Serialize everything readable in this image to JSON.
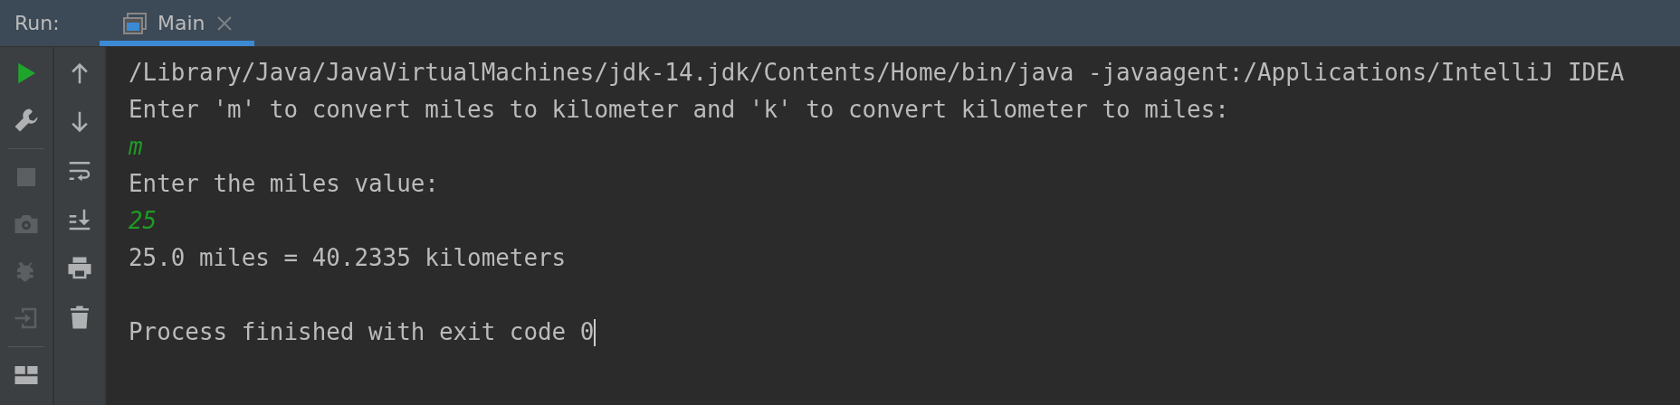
{
  "header": {
    "label": "Run:",
    "tabs": [
      {
        "label": "Main",
        "selected": true
      }
    ]
  },
  "toolbar": [
    {
      "kind": "run",
      "disabled": false
    },
    {
      "kind": "wrench",
      "disabled": false
    },
    {
      "kind": "separator"
    },
    {
      "kind": "stop",
      "disabled": true
    },
    {
      "kind": "camera",
      "disabled": true
    },
    {
      "kind": "bug",
      "disabled": true
    },
    {
      "kind": "exit",
      "disabled": true
    },
    {
      "kind": "separator"
    },
    {
      "kind": "layout",
      "disabled": false
    }
  ],
  "console_toolbar": [
    {
      "kind": "up"
    },
    {
      "kind": "down"
    },
    {
      "kind": "wrap"
    },
    {
      "kind": "scroll-end"
    },
    {
      "kind": "print"
    },
    {
      "kind": "trash"
    }
  ],
  "console": {
    "lines": [
      {
        "kind": "output",
        "text": "/Library/Java/JavaVirtualMachines/jdk-14.jdk/Contents/Home/bin/java -javaagent:/Applications/IntelliJ IDEA"
      },
      {
        "kind": "output",
        "text": "Enter 'm' to convert miles to kilometer and 'k' to convert kilometer to miles:"
      },
      {
        "kind": "input",
        "text": "m"
      },
      {
        "kind": "output",
        "text": "Enter the miles value:"
      },
      {
        "kind": "input",
        "text": "25"
      },
      {
        "kind": "output",
        "text": "25.0 miles = 40.2335 kilometers"
      },
      {
        "kind": "output",
        "text": "Process finished with exit code 0",
        "blank_before": true,
        "cursor": true
      }
    ]
  }
}
